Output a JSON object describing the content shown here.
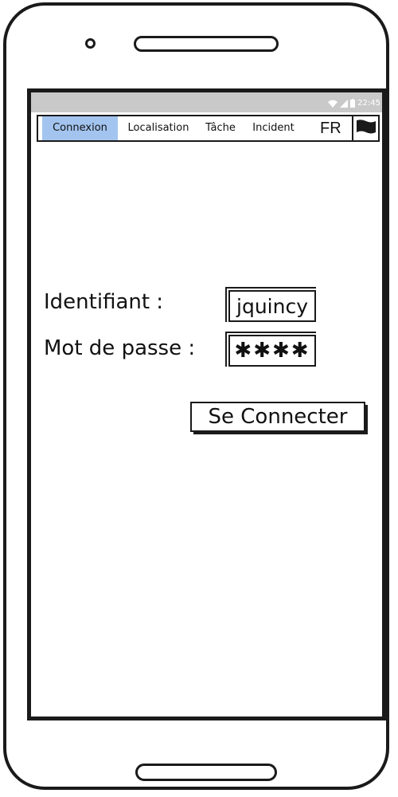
{
  "status_bar": {
    "time": "22:45",
    "icons": [
      "wifi-icon",
      "signal-icon",
      "battery-icon"
    ]
  },
  "tabs": [
    {
      "label": "Connexion",
      "active": true
    },
    {
      "label": "Localisation",
      "active": false
    },
    {
      "label": "Tâche",
      "active": false
    },
    {
      "label": "Incident",
      "active": false
    }
  ],
  "language": {
    "label": "FR",
    "icon": "flag-icon"
  },
  "login_form": {
    "username_label": "Identifiant :",
    "username_value": "jquincy",
    "password_label": "Mot de passe :",
    "password_value": "✱✱✱✱",
    "submit_label": "Se Connecter"
  },
  "colors": {
    "active_tab": "#a3c4ef",
    "status_bar": "#c9c9c9",
    "outline": "#1a1a1a"
  }
}
